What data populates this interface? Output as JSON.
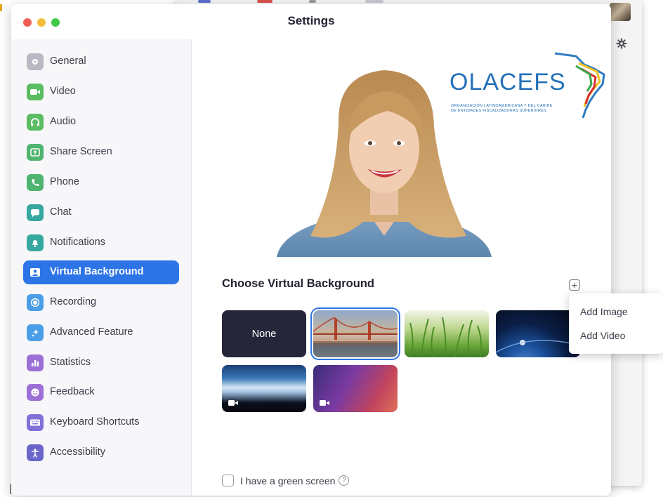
{
  "window": {
    "title": "Settings"
  },
  "colors": {
    "accent": "#2d74e6",
    "close": "#ef5e56",
    "minimize": "#f3bd3d",
    "zoom": "#3ec746",
    "none_tile": "#26263a",
    "logo_blue": "#2471b8"
  },
  "sidebar": {
    "items": [
      {
        "label": "General",
        "icon": "gear-icon",
        "color": "#b9b9c3",
        "active": false
      },
      {
        "label": "Video",
        "icon": "video-camera-icon",
        "color": "#5bbd62",
        "active": false
      },
      {
        "label": "Audio",
        "icon": "headphones-icon",
        "color": "#5bbd62",
        "active": false
      },
      {
        "label": "Share Screen",
        "icon": "share-screen-icon",
        "color": "#4fb46f",
        "active": false
      },
      {
        "label": "Phone",
        "icon": "phone-icon",
        "color": "#4fb46f",
        "active": false
      },
      {
        "label": "Chat",
        "icon": "chat-bubble-icon",
        "color": "#36a8a0",
        "active": false
      },
      {
        "label": "Notifications",
        "icon": "bell-icon",
        "color": "#36a8a0",
        "active": false
      },
      {
        "label": "Virtual Background",
        "icon": "portrait-icon",
        "color": "#ffffff",
        "active": true
      },
      {
        "label": "Recording",
        "icon": "record-icon",
        "color": "#4a9ee8",
        "active": false
      },
      {
        "label": "Advanced Feature",
        "icon": "sparkle-icon",
        "color": "#4a9ee8",
        "active": false
      },
      {
        "label": "Statistics",
        "icon": "bar-chart-icon",
        "color": "#9b6fd6",
        "active": false
      },
      {
        "label": "Feedback",
        "icon": "smiley-icon",
        "color": "#9b6fd6",
        "active": false
      },
      {
        "label": "Keyboard Shortcuts",
        "icon": "keyboard-icon",
        "color": "#8070d8",
        "active": false
      },
      {
        "label": "Accessibility",
        "icon": "accessibility-icon",
        "color": "#6a66c9",
        "active": false
      }
    ]
  },
  "preview": {
    "logo_text": "OLACEFS",
    "logo_line1": "ORGANIZACIÓN LATINOAMERICANA Y DEL CARIBE",
    "logo_line2": "DE ENTIDADES FISCALIZADORAS SUPERIORES"
  },
  "backgrounds": {
    "section_title": "Choose Virtual Background",
    "add_icon": "plus-icon",
    "none_label": "None",
    "tiles": [
      {
        "name": "none",
        "selected": false,
        "video": false
      },
      {
        "name": "golden-gate-bridge",
        "selected": true,
        "video": false
      },
      {
        "name": "grass",
        "selected": false,
        "video": false
      },
      {
        "name": "earth-from-space",
        "selected": false,
        "video": false
      },
      {
        "name": "northern-lights",
        "selected": false,
        "video": true
      },
      {
        "name": "purple-gradient",
        "selected": false,
        "video": true
      }
    ]
  },
  "green_screen": {
    "label": "I have a green screen",
    "checked": false,
    "help_icon": "question-circle-icon"
  },
  "add_menu": {
    "items": [
      "Add Image",
      "Add Video"
    ]
  }
}
